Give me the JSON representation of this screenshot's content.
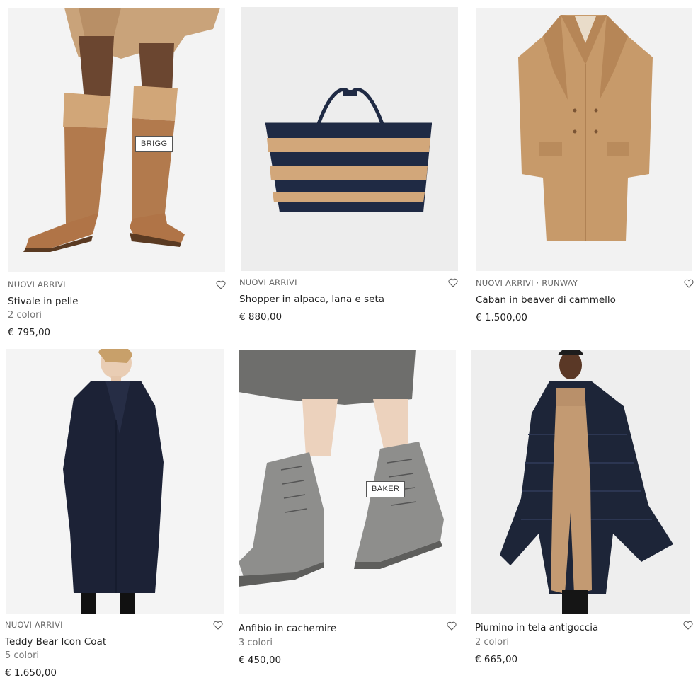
{
  "products": [
    {
      "badge": "NUOVI ARRIVI",
      "name": "Stivale in pelle",
      "colors": "2 colori",
      "price": "€ 795,00",
      "tag": "BRIGG",
      "icon": "heart-outline-icon"
    },
    {
      "badge": "NUOVI ARRIVI",
      "name": "Shopper in alpaca, lana e seta",
      "colors": "",
      "price": "€ 880,00",
      "tag": "",
      "icon": "heart-outline-icon"
    },
    {
      "badge": "NUOVI ARRIVI · RUNWAY",
      "name": "Caban in beaver di cammello",
      "colors": "",
      "price": "€ 1.500,00",
      "tag": "",
      "icon": "heart-outline-icon"
    },
    {
      "badge": "NUOVI ARRIVI",
      "name": "Teddy Bear Icon Coat",
      "colors": "5 colori",
      "price": "€ 1.650,00",
      "tag": "",
      "icon": "heart-outline-icon"
    },
    {
      "badge": "",
      "name": "Anfibio in cachemire",
      "colors": "3 colori",
      "price": "€ 450,00",
      "tag": "BAKER",
      "icon": "heart-outline-icon"
    },
    {
      "badge": "",
      "name": "Piumino in tela antigoccia",
      "colors": "2 colori",
      "price": "€ 665,00",
      "tag": "",
      "icon": "heart-outline-icon"
    }
  ],
  "colors": {
    "camel": "#c79a6a",
    "navy": "#1f2a44",
    "grey_felt": "#8e8e8c",
    "image_bg": "#efefef"
  }
}
